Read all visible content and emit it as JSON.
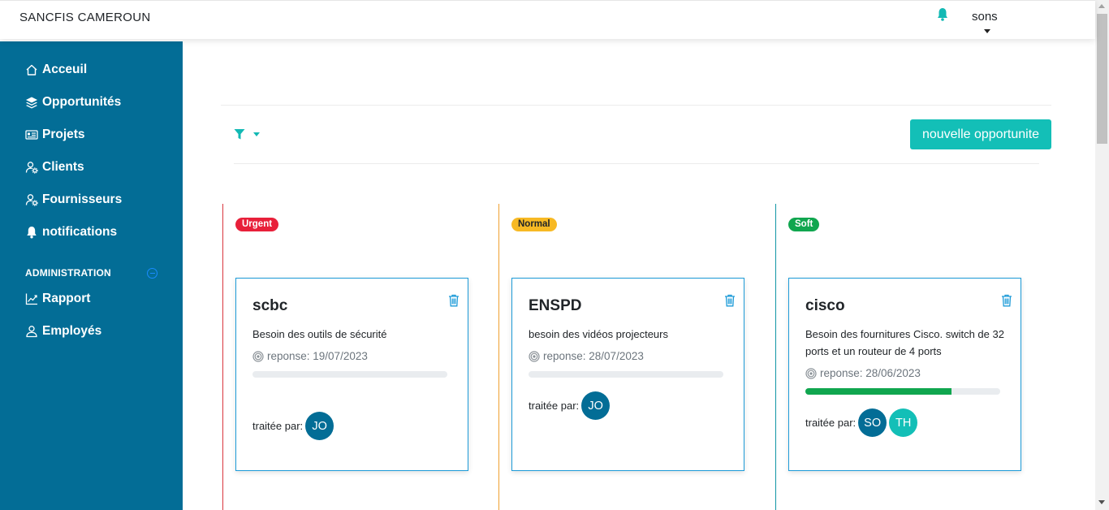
{
  "app": {
    "brand": "SANCFIS CAMEROUN",
    "user": "sons"
  },
  "sidebar": {
    "items": [
      {
        "label": "Acceuil",
        "icon": "home-icon"
      },
      {
        "label": "Opportunités",
        "icon": "layers-icon"
      },
      {
        "label": "Projets",
        "icon": "id-card-icon"
      },
      {
        "label": "Clients",
        "icon": "user-cog-icon"
      },
      {
        "label": "Fournisseurs",
        "icon": "user-cog-icon"
      },
      {
        "label": "notifications",
        "icon": "bell-icon"
      }
    ],
    "admin_label": "ADMINISTRATION",
    "admin_items": [
      {
        "label": "Rapport",
        "icon": "chart-line-icon"
      },
      {
        "label": "Employés",
        "icon": "user-icon"
      }
    ]
  },
  "toolbar": {
    "new_button": "nouvelle opportunite"
  },
  "columns": [
    {
      "badge": "Urgent",
      "badge_color": "#e8203a",
      "line_color": "#d9363e",
      "card": {
        "title": "scbc",
        "description": "Besoin des outils de sécurité",
        "response": "reponse: 19/07/2023",
        "progress": 0,
        "treated_label": "traitée par:",
        "assignees": [
          {
            "initials": "JO",
            "color": "#036d96"
          }
        ]
      }
    },
    {
      "badge": "Normal",
      "badge_color": "#f7b924",
      "line_color": "#f0a030",
      "card": {
        "title": "ENSPD",
        "description": "besoin des vidéos projecteurs",
        "response": "reponse: 28/07/2023",
        "progress": 0,
        "treated_label": "traitée par:",
        "assignees": [
          {
            "initials": "JO",
            "color": "#036d96"
          }
        ]
      }
    },
    {
      "badge": "Soft",
      "badge_color": "#10a64f",
      "line_color": "#1296a5",
      "card": {
        "title": "cisco",
        "description": "Besoin des fournitures Cisco. switch de 32 ports et un routeur de 4 ports",
        "response": "reponse: 28/06/2023",
        "progress": 0.75,
        "treated_label": "traitée par:",
        "assignees": [
          {
            "initials": "SO",
            "color": "#036d96"
          },
          {
            "initials": "TH",
            "color": "#13bfb7"
          }
        ]
      }
    }
  ]
}
